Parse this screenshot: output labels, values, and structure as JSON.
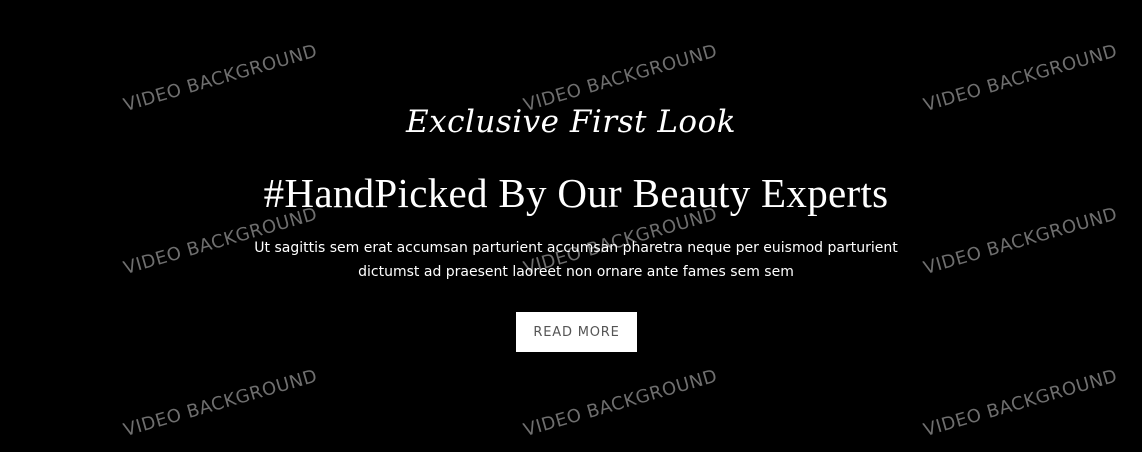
{
  "watermark": {
    "text": "VIDEO BACKGROUND"
  },
  "hero": {
    "eyebrow": "Exclusive First Look",
    "headline": "#HandPicked By Our Beauty Experts",
    "description": "Ut sagittis sem erat accumsan parturient accumsan pharetra neque per euismod parturient dictumst ad praesent laoreet non ornare ante fames sem sem",
    "button_label": "READ MORE"
  },
  "colors": {
    "background": "#000000",
    "text": "#ffffff",
    "button_bg": "#ffffff",
    "button_text": "#555555",
    "watermark": "#6f6f6f"
  }
}
